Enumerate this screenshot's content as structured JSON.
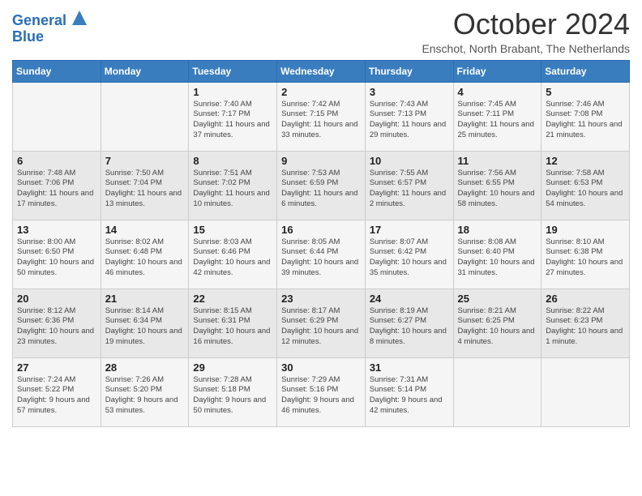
{
  "logo": {
    "line1": "General",
    "line2": "Blue"
  },
  "title": "October 2024",
  "location": "Enschot, North Brabant, The Netherlands",
  "days_header": [
    "Sunday",
    "Monday",
    "Tuesday",
    "Wednesday",
    "Thursday",
    "Friday",
    "Saturday"
  ],
  "weeks": [
    [
      {
        "day": "",
        "info": ""
      },
      {
        "day": "",
        "info": ""
      },
      {
        "day": "1",
        "info": "Sunrise: 7:40 AM\nSunset: 7:17 PM\nDaylight: 11 hours and 37 minutes."
      },
      {
        "day": "2",
        "info": "Sunrise: 7:42 AM\nSunset: 7:15 PM\nDaylight: 11 hours and 33 minutes."
      },
      {
        "day": "3",
        "info": "Sunrise: 7:43 AM\nSunset: 7:13 PM\nDaylight: 11 hours and 29 minutes."
      },
      {
        "day": "4",
        "info": "Sunrise: 7:45 AM\nSunset: 7:11 PM\nDaylight: 11 hours and 25 minutes."
      },
      {
        "day": "5",
        "info": "Sunrise: 7:46 AM\nSunset: 7:08 PM\nDaylight: 11 hours and 21 minutes."
      }
    ],
    [
      {
        "day": "6",
        "info": "Sunrise: 7:48 AM\nSunset: 7:06 PM\nDaylight: 11 hours and 17 minutes."
      },
      {
        "day": "7",
        "info": "Sunrise: 7:50 AM\nSunset: 7:04 PM\nDaylight: 11 hours and 13 minutes."
      },
      {
        "day": "8",
        "info": "Sunrise: 7:51 AM\nSunset: 7:02 PM\nDaylight: 11 hours and 10 minutes."
      },
      {
        "day": "9",
        "info": "Sunrise: 7:53 AM\nSunset: 6:59 PM\nDaylight: 11 hours and 6 minutes."
      },
      {
        "day": "10",
        "info": "Sunrise: 7:55 AM\nSunset: 6:57 PM\nDaylight: 11 hours and 2 minutes."
      },
      {
        "day": "11",
        "info": "Sunrise: 7:56 AM\nSunset: 6:55 PM\nDaylight: 10 hours and 58 minutes."
      },
      {
        "day": "12",
        "info": "Sunrise: 7:58 AM\nSunset: 6:53 PM\nDaylight: 10 hours and 54 minutes."
      }
    ],
    [
      {
        "day": "13",
        "info": "Sunrise: 8:00 AM\nSunset: 6:50 PM\nDaylight: 10 hours and 50 minutes."
      },
      {
        "day": "14",
        "info": "Sunrise: 8:02 AM\nSunset: 6:48 PM\nDaylight: 10 hours and 46 minutes."
      },
      {
        "day": "15",
        "info": "Sunrise: 8:03 AM\nSunset: 6:46 PM\nDaylight: 10 hours and 42 minutes."
      },
      {
        "day": "16",
        "info": "Sunrise: 8:05 AM\nSunset: 6:44 PM\nDaylight: 10 hours and 39 minutes."
      },
      {
        "day": "17",
        "info": "Sunrise: 8:07 AM\nSunset: 6:42 PM\nDaylight: 10 hours and 35 minutes."
      },
      {
        "day": "18",
        "info": "Sunrise: 8:08 AM\nSunset: 6:40 PM\nDaylight: 10 hours and 31 minutes."
      },
      {
        "day": "19",
        "info": "Sunrise: 8:10 AM\nSunset: 6:38 PM\nDaylight: 10 hours and 27 minutes."
      }
    ],
    [
      {
        "day": "20",
        "info": "Sunrise: 8:12 AM\nSunset: 6:36 PM\nDaylight: 10 hours and 23 minutes."
      },
      {
        "day": "21",
        "info": "Sunrise: 8:14 AM\nSunset: 6:34 PM\nDaylight: 10 hours and 19 minutes."
      },
      {
        "day": "22",
        "info": "Sunrise: 8:15 AM\nSunset: 6:31 PM\nDaylight: 10 hours and 16 minutes."
      },
      {
        "day": "23",
        "info": "Sunrise: 8:17 AM\nSunset: 6:29 PM\nDaylight: 10 hours and 12 minutes."
      },
      {
        "day": "24",
        "info": "Sunrise: 8:19 AM\nSunset: 6:27 PM\nDaylight: 10 hours and 8 minutes."
      },
      {
        "day": "25",
        "info": "Sunrise: 8:21 AM\nSunset: 6:25 PM\nDaylight: 10 hours and 4 minutes."
      },
      {
        "day": "26",
        "info": "Sunrise: 8:22 AM\nSunset: 6:23 PM\nDaylight: 10 hours and 1 minute."
      }
    ],
    [
      {
        "day": "27",
        "info": "Sunrise: 7:24 AM\nSunset: 5:22 PM\nDaylight: 9 hours and 57 minutes."
      },
      {
        "day": "28",
        "info": "Sunrise: 7:26 AM\nSunset: 5:20 PM\nDaylight: 9 hours and 53 minutes."
      },
      {
        "day": "29",
        "info": "Sunrise: 7:28 AM\nSunset: 5:18 PM\nDaylight: 9 hours and 50 minutes."
      },
      {
        "day": "30",
        "info": "Sunrise: 7:29 AM\nSunset: 5:16 PM\nDaylight: 9 hours and 46 minutes."
      },
      {
        "day": "31",
        "info": "Sunrise: 7:31 AM\nSunset: 5:14 PM\nDaylight: 9 hours and 42 minutes."
      },
      {
        "day": "",
        "info": ""
      },
      {
        "day": "",
        "info": ""
      }
    ]
  ]
}
